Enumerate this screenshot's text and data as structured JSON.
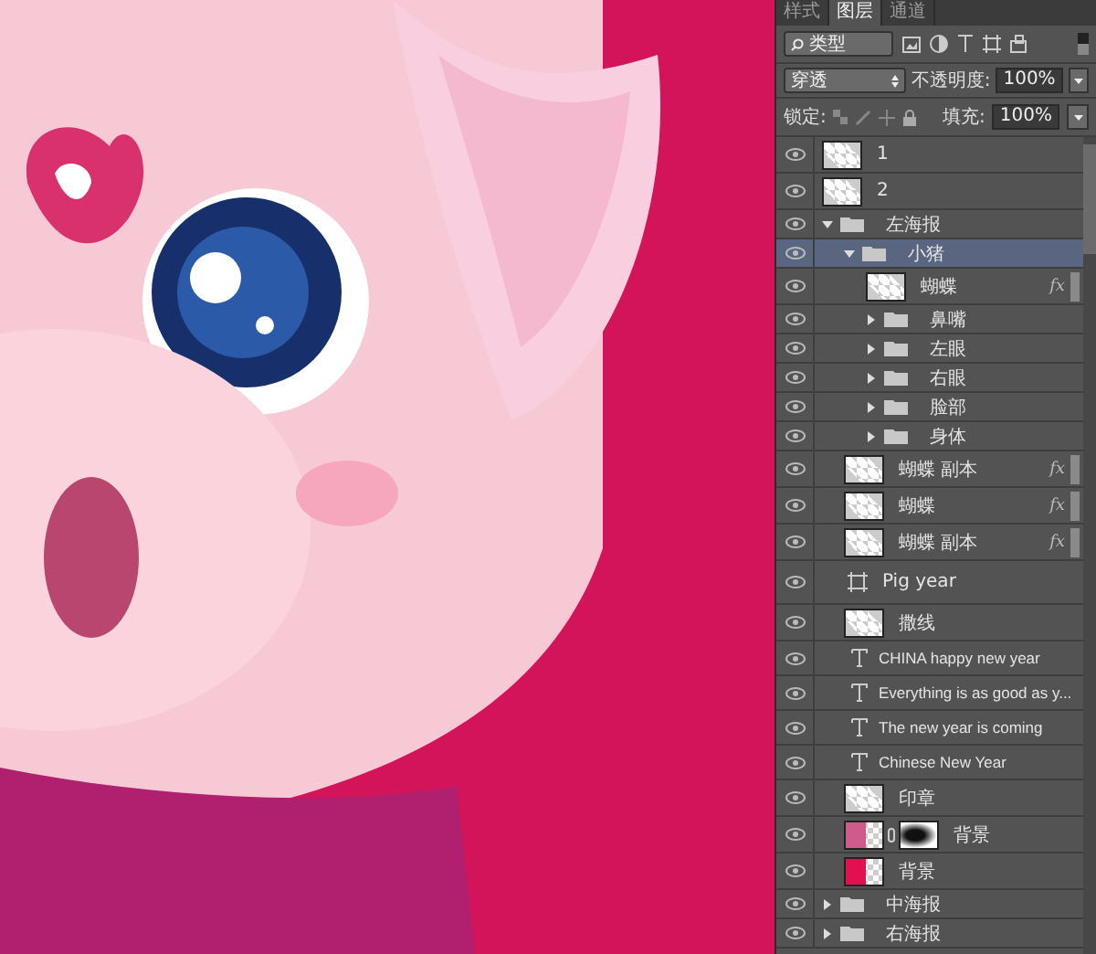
{
  "tabs": [
    {
      "label": "样式",
      "selected": false
    },
    {
      "label": "图层",
      "selected": true
    },
    {
      "label": "通道",
      "selected": false
    }
  ],
  "filter": {
    "kind": "类型"
  },
  "blend": {
    "mode": "穿透",
    "opacity_label": "不透明度:",
    "opacity": "100%"
  },
  "lock": {
    "label": "锁定:",
    "fill_label": "填充:",
    "fill": "100%"
  },
  "layers": [
    {
      "kind": "pixel",
      "name": "1",
      "visible": true
    },
    {
      "kind": "pixel",
      "name": "2",
      "visible": true
    },
    {
      "kind": "group",
      "name": "左海报",
      "visible": true,
      "expanded": true,
      "selected": false,
      "children": [
        {
          "kind": "group",
          "name": "小猪",
          "visible": true,
          "expanded": true,
          "selected": true,
          "children": [
            {
              "kind": "pixel",
              "name": "蝴蝶",
              "visible": true,
              "fx": "fx"
            },
            {
              "kind": "group",
              "name": "鼻嘴",
              "visible": true,
              "expanded": false
            },
            {
              "kind": "group",
              "name": "左眼",
              "visible": true,
              "expanded": false
            },
            {
              "kind": "group",
              "name": "右眼",
              "visible": true,
              "expanded": false
            },
            {
              "kind": "group",
              "name": "脸部",
              "visible": true,
              "expanded": false
            },
            {
              "kind": "group",
              "name": "身体",
              "visible": true,
              "expanded": false
            }
          ]
        },
        {
          "kind": "pixel",
          "name": "蝴蝶 副本",
          "visible": true,
          "fx": "fx"
        },
        {
          "kind": "pixel",
          "name": "蝴蝶",
          "visible": true,
          "fx": "fx"
        },
        {
          "kind": "pixel",
          "name": "蝴蝶 副本",
          "visible": true,
          "fx": "fx"
        },
        {
          "kind": "shape",
          "name": "Pig year",
          "visible": true
        },
        {
          "kind": "pixel",
          "name": "撒线",
          "visible": true
        },
        {
          "kind": "text",
          "name": "CHINA  happy new year",
          "visible": true
        },
        {
          "kind": "text",
          "name": "Everything is as good as y...",
          "visible": true
        },
        {
          "kind": "text",
          "name": "The new year is coming",
          "visible": true
        },
        {
          "kind": "text",
          "name": "Chinese New Year",
          "visible": true
        },
        {
          "kind": "pixel",
          "name": "印章",
          "visible": true
        },
        {
          "kind": "masked",
          "name": "背景",
          "visible": true
        },
        {
          "kind": "pixel",
          "name": "背景",
          "visible": true,
          "color": "#e3104f"
        }
      ]
    },
    {
      "kind": "group",
      "name": "中海报",
      "visible": true,
      "expanded": false
    },
    {
      "kind": "group",
      "name": "右海报",
      "visible": true,
      "expanded": false
    }
  ]
}
